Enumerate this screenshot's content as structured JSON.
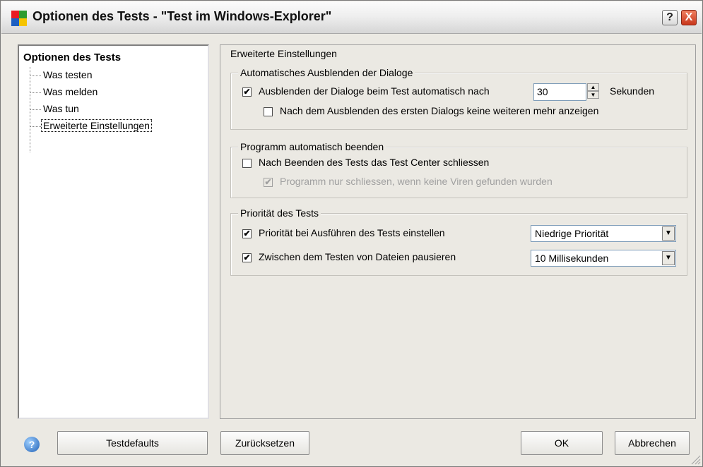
{
  "window": {
    "title": "Optionen des Tests - \"Test im Windows-Explorer\"",
    "help_glyph": "?",
    "close_glyph": "X"
  },
  "tree": {
    "root": "Optionen des Tests",
    "items": [
      {
        "label": "Was testen"
      },
      {
        "label": "Was melden"
      },
      {
        "label": "Was tun"
      },
      {
        "label": "Erweiterte Einstellungen",
        "selected": true
      }
    ]
  },
  "panel": {
    "title": "Erweiterte Einstellungen",
    "auto_hide": {
      "legend": "Automatisches Ausblenden der Dialoge",
      "hide_dialogs": {
        "label": "Ausblenden der Dialoge beim Test automatisch nach",
        "checked": true
      },
      "seconds_value": "30",
      "seconds_unit": "Sekunden",
      "no_more_dialogs": {
        "label": "Nach dem Ausblenden des ersten Dialogs keine weiteren mehr anzeigen",
        "checked": false
      }
    },
    "auto_exit": {
      "legend": "Programm automatisch beenden",
      "close_center": {
        "label": "Nach Beenden des Tests das Test Center schliessen",
        "checked": false
      },
      "only_no_virus": {
        "label": "Programm nur schliessen, wenn keine Viren gefunden wurden",
        "checked": true,
        "disabled": true
      }
    },
    "priority": {
      "legend": "Priorität des Tests",
      "set_priority": {
        "label": "Priorität bei Ausführen des Tests einstellen",
        "checked": true
      },
      "priority_value": "Niedrige Priorität",
      "pause_files": {
        "label": "Zwischen dem Testen von Dateien pausieren",
        "checked": true
      },
      "pause_value": "10 Millisekunden"
    }
  },
  "buttons": {
    "help_icon": "?",
    "defaults": "Testdefaults",
    "reset": "Zurücksetzen",
    "ok": "OK",
    "cancel": "Abbrechen"
  },
  "icons": {
    "app": "windows-logo-icon",
    "checkmark": "✔",
    "dropdown": "▼",
    "spin_up": "▲",
    "spin_down": "▼"
  },
  "colors": {
    "window_bg": "#ebe9e3",
    "close_red": "#c8361c",
    "help_blue": "#1f5fb5"
  }
}
